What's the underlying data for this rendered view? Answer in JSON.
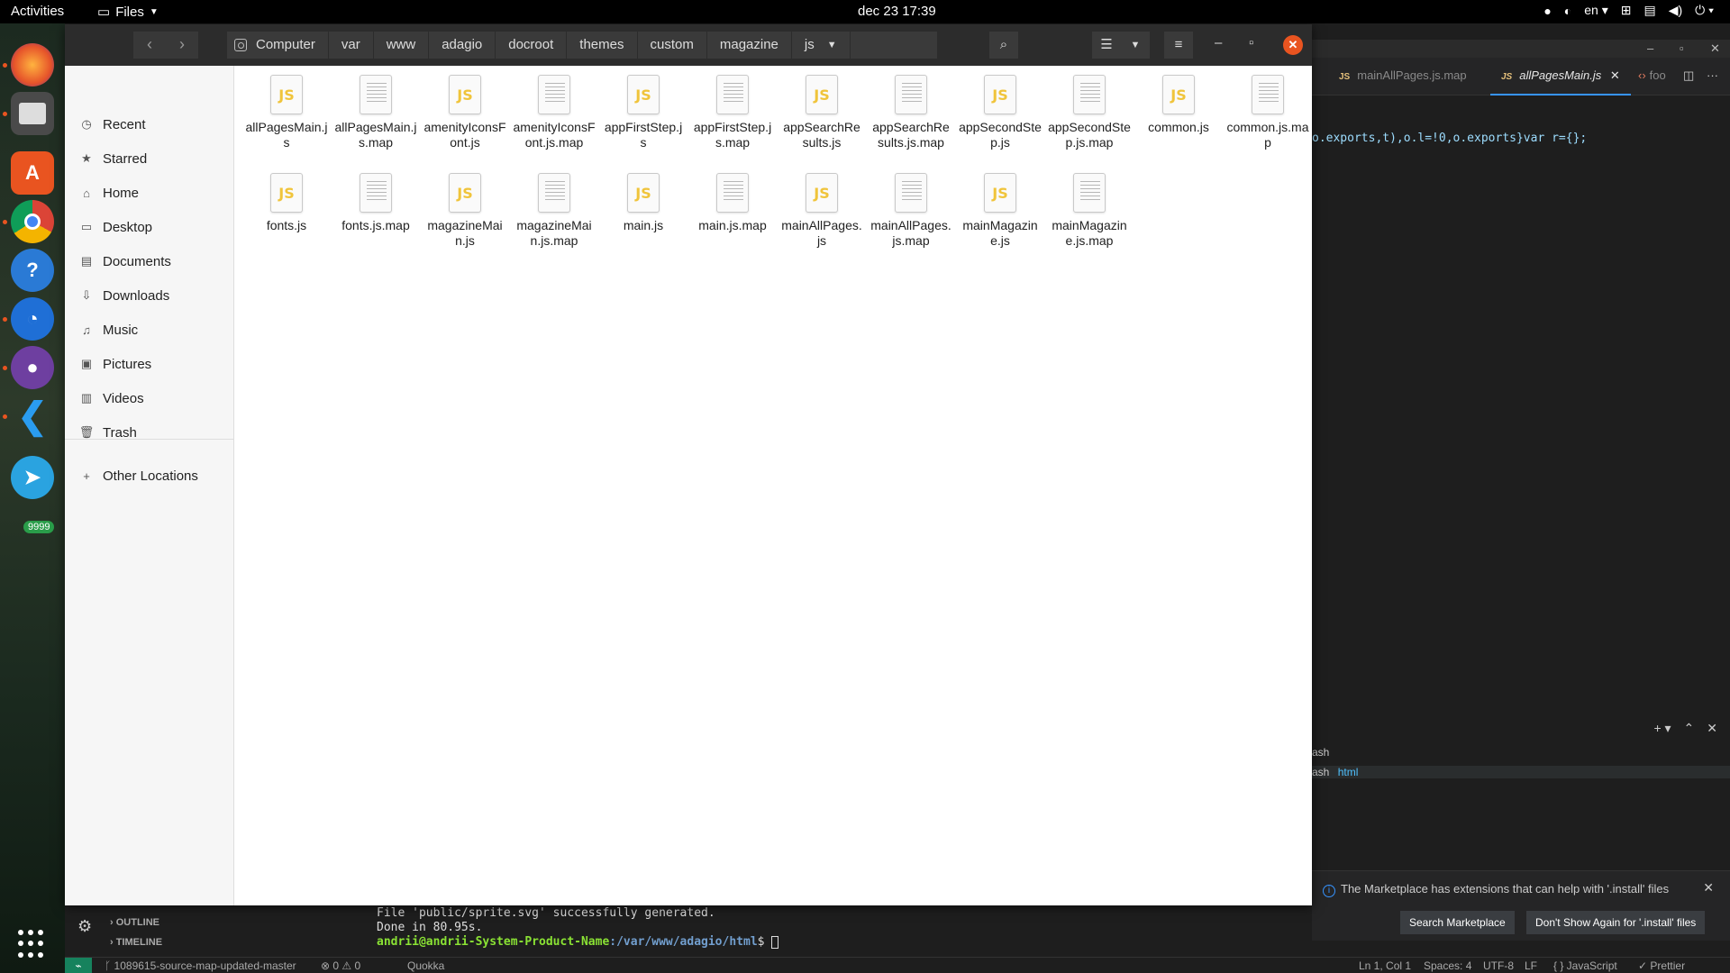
{
  "topbar": {
    "activities": "Activities",
    "app_menu": "Files",
    "clock": "dec 23  17:39",
    "lang": "en"
  },
  "dock": {
    "apps": [
      "Firefox",
      "Files",
      "Ubuntu Software",
      "Chrome",
      "Help",
      "Clock",
      "GitHub Desktop",
      "VS Code",
      "Telegram"
    ],
    "telegram_badge": "9999"
  },
  "files": {
    "breadcrumbs": [
      "Computer",
      "var",
      "www",
      "adagio",
      "docroot",
      "themes",
      "custom",
      "magazine",
      "js"
    ],
    "sidebar": [
      {
        "label": "Recent",
        "icon": "clock-icon",
        "glyph": "◷"
      },
      {
        "label": "Starred",
        "icon": "star-icon",
        "glyph": "★"
      },
      {
        "label": "Home",
        "icon": "home-icon",
        "glyph": "⌂"
      },
      {
        "label": "Desktop",
        "icon": "desktop-icon",
        "glyph": "▭"
      },
      {
        "label": "Documents",
        "icon": "document-icon",
        "glyph": "▤"
      },
      {
        "label": "Downloads",
        "icon": "download-icon",
        "glyph": "⇩"
      },
      {
        "label": "Music",
        "icon": "music-icon",
        "glyph": "♫"
      },
      {
        "label": "Pictures",
        "icon": "pictures-icon",
        "glyph": "▣"
      },
      {
        "label": "Videos",
        "icon": "video-icon",
        "glyph": "▥"
      },
      {
        "label": "Trash",
        "icon": "trash-icon",
        "glyph": "🗑"
      }
    ],
    "other_locations": "Other Locations",
    "items": [
      {
        "name": "allPagesMain.js",
        "type": "js"
      },
      {
        "name": "allPagesMain.js.map",
        "type": "doc"
      },
      {
        "name": "amenityIconsFont.js",
        "type": "js"
      },
      {
        "name": "amenityIconsFont.js.map",
        "type": "doc"
      },
      {
        "name": "appFirstStep.js",
        "type": "js"
      },
      {
        "name": "appFirstStep.js.map",
        "type": "doc"
      },
      {
        "name": "appSearchResults.js",
        "type": "js"
      },
      {
        "name": "appSearchResults.js.map",
        "type": "doc"
      },
      {
        "name": "appSecondStep.js",
        "type": "js"
      },
      {
        "name": "appSecondStep.js.map",
        "type": "doc"
      },
      {
        "name": "common.js",
        "type": "js"
      },
      {
        "name": "common.js.map",
        "type": "doc"
      },
      {
        "name": "fonts.js",
        "type": "js"
      },
      {
        "name": "fonts.js.map",
        "type": "doc"
      },
      {
        "name": "magazineMain.js",
        "type": "js"
      },
      {
        "name": "magazineMain.js.map",
        "type": "doc"
      },
      {
        "name": "main.js",
        "type": "js"
      },
      {
        "name": "main.js.map",
        "type": "doc"
      },
      {
        "name": "mainAllPages.js",
        "type": "js"
      },
      {
        "name": "mainAllPages.js.map",
        "type": "doc"
      },
      {
        "name": "mainMagazine.js",
        "type": "js"
      },
      {
        "name": "mainMagazine.js.map",
        "type": "doc"
      }
    ]
  },
  "vscode": {
    "tab1": "mainAllPages.js.map",
    "tab2": "allPagesMain.js",
    "tab3": "foo",
    "code_line": "o.exports,t),o.l=!0,o.exports}var r={};",
    "term_tab1": "ash",
    "term_tab2": "ash",
    "term_tab2_sub": "html",
    "notification": "The Marketplace has extensions that can help with '.install' files",
    "btn_search": "Search Marketplace",
    "btn_dont_show": "Don't Show Again for '.install' files",
    "outline": "OUTLINE",
    "timeline": "TIMELINE",
    "terminal_line1": "File 'public/sprite.svg' successfully generated.",
    "terminal_line2": "Done in 80.95s.",
    "prompt_user": "andrii@andrii-System-Product-Name",
    "prompt_path": ":/var/www/adagio/html",
    "prompt_suffix": "$ ",
    "status": {
      "branch": "1089615-source-map-updated-master",
      "problems": "⊗ 0 ⚠ 0",
      "quokka": "Quokka",
      "position": "Ln 1, Col 1",
      "spaces": "Spaces: 4",
      "encoding": "UTF-8",
      "eol": "LF",
      "language": "{ } JavaScript",
      "prettier": "✓ Prettier"
    }
  }
}
